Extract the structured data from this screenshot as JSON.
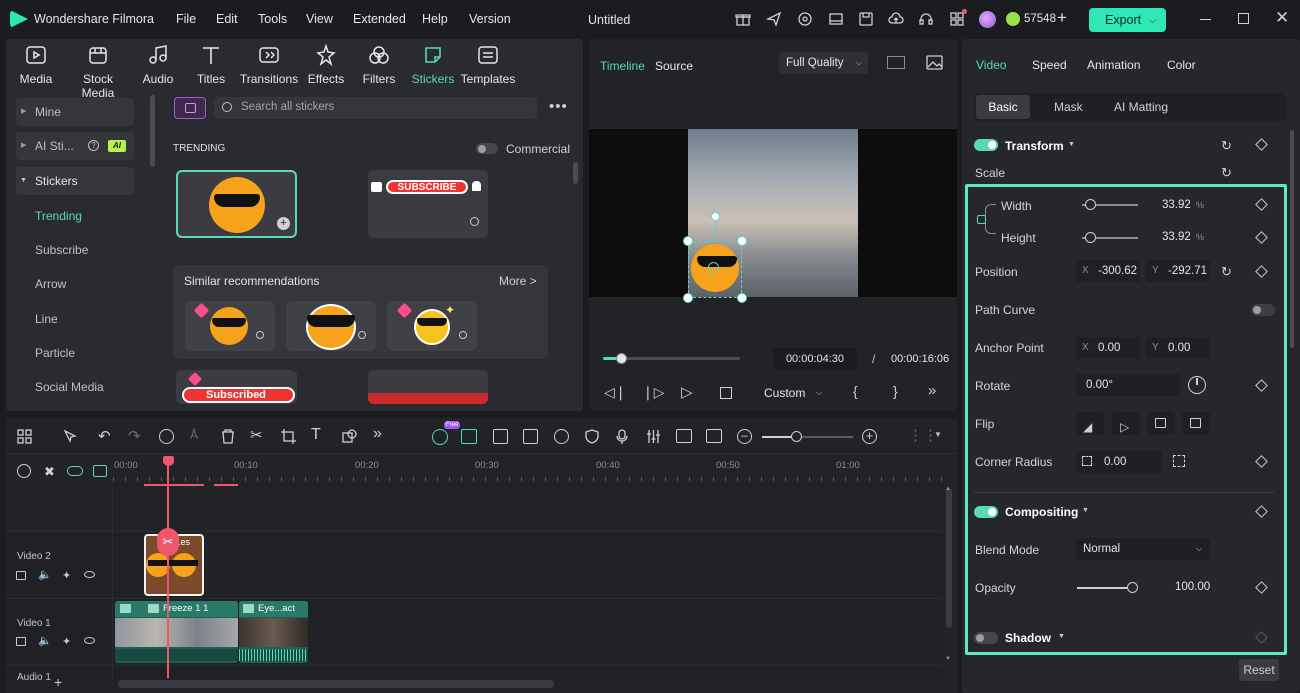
{
  "app": {
    "name": "Wondershare Filmora",
    "title": "Untitled",
    "credits": "57548",
    "export_label": "Export"
  },
  "menu": [
    "File",
    "Edit",
    "Tools",
    "View",
    "Extended",
    "Help",
    "Version"
  ],
  "media_tabs": [
    "Media",
    "Stock Media",
    "Audio",
    "Titles",
    "Transitions",
    "Effects",
    "Filters",
    "Stickers",
    "Templates"
  ],
  "sidebar": {
    "items": [
      {
        "label": "Mine"
      },
      {
        "label": "AI Sti...",
        "badge": "AI"
      },
      {
        "label": "Stickers"
      }
    ],
    "sub_items": [
      "Trending",
      "Subscribe",
      "Arrow",
      "Line",
      "Particle",
      "Social Media"
    ]
  },
  "stickers": {
    "search_placeholder": "Search all stickers",
    "section": "TRENDING",
    "commercial_label": "Commercial",
    "subscribe_text": "SUBSCRIBE",
    "subscribed_text": "Subscribed",
    "similar_title": "Similar recommendations",
    "more_label": "More >"
  },
  "preview": {
    "tabs": [
      "Timeline",
      "Source"
    ],
    "quality": "Full Quality",
    "current_time": "00:00:04:30",
    "separator": "/",
    "total_time": "00:00:16:06",
    "zoom_option": "Custom",
    "progress": 0.13
  },
  "props": {
    "tabs": [
      "Video",
      "Speed",
      "Animation",
      "Color"
    ],
    "subtabs": [
      "Basic",
      "Mask",
      "AI Matting"
    ],
    "transform": "Transform",
    "scale": "Scale",
    "width": {
      "label": "Width",
      "value": "33.92",
      "unit": "%"
    },
    "height": {
      "label": "Height",
      "value": "33.92",
      "unit": "%"
    },
    "position": {
      "label": "Position",
      "x_label": "X",
      "x": "-300.62",
      "y_label": "Y",
      "y": "-292.71"
    },
    "path_curve": "Path Curve",
    "anchor": {
      "label": "Anchor Point",
      "x_label": "X",
      "x": "0.00",
      "y_label": "Y",
      "y": "0.00"
    },
    "rotate": {
      "label": "Rotate",
      "value": "0.00°"
    },
    "flip": "Flip",
    "corner": {
      "label": "Corner Radius",
      "value": "0.00"
    },
    "compositing": "Compositing",
    "blend": {
      "label": "Blend Mode",
      "value": "Normal"
    },
    "opacity": {
      "label": "Opacity",
      "value": "100.00"
    },
    "shadow": "Shadow",
    "reset": "Reset"
  },
  "timeline": {
    "ticks": [
      "00:00",
      "00:10",
      "00:20",
      "00:30",
      "00:40",
      "00:50",
      "01:00"
    ],
    "tracks": [
      {
        "label": "Video 2"
      },
      {
        "label": "Video 1"
      },
      {
        "label": "Audio 1"
      }
    ],
    "clips": {
      "sticker": "...es",
      "freeze": "Freeze 1 1",
      "eye": "Eye...act"
    },
    "free_badge": "Free"
  },
  "colors": {
    "accent": "#58d9b8",
    "highlight_box": "#5ee8c4",
    "playhead": "#f0566b",
    "export": "#2fe6b5"
  }
}
